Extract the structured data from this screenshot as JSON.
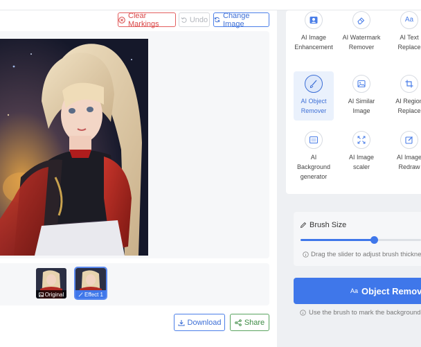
{
  "toolbar": {
    "clear_label": "Clear Markings",
    "undo_label": "Undo",
    "change_label": "Change Image"
  },
  "thumbnails": [
    {
      "label": "Original"
    },
    {
      "label": "Effect 1",
      "selected": true
    }
  ],
  "actions": {
    "download_label": "Download",
    "share_label": "Share"
  },
  "tools": [
    {
      "label": "AI Image Enhancement",
      "icon": "person-image-icon"
    },
    {
      "label": "AI Watermark Remover",
      "icon": "eraser-icon"
    },
    {
      "label": "AI Text Replace",
      "icon": "text-aa-icon"
    },
    {
      "label": "AI Object Remover",
      "icon": "brush-icon",
      "active": true
    },
    {
      "label": "AI Similar Image",
      "icon": "image-icon"
    },
    {
      "label": "AI Region Replace",
      "icon": "crop-icon"
    },
    {
      "label": "AI Background generator",
      "icon": "background-image-icon"
    },
    {
      "label": "AI Image scaler",
      "icon": "expand-arrows-icon"
    },
    {
      "label": "AI Image Redraw",
      "icon": "pencil-square-icon"
    }
  ],
  "brush": {
    "title": "Brush Size",
    "value_fraction": 0.61,
    "hint": "Drag the slider to adjust brush thickness"
  },
  "primary_action": {
    "prefix": "Aa",
    "label": "Object Removal"
  },
  "footer_hint": "Use the brush to mark the background a",
  "colors": {
    "accent": "#3f77ea",
    "danger": "#d94848",
    "success": "#3d8a44"
  }
}
